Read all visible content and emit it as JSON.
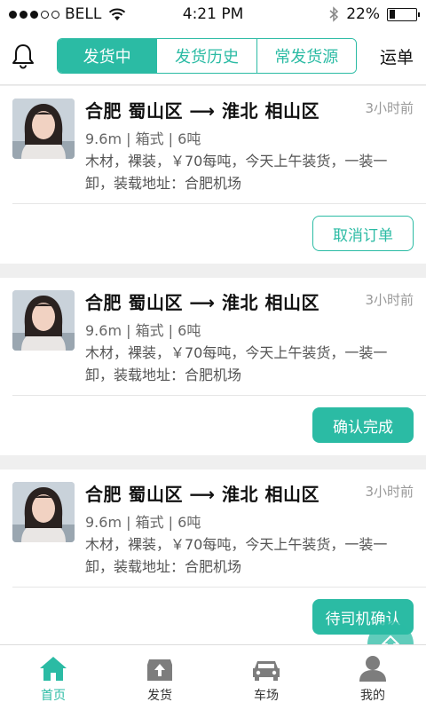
{
  "status_bar": {
    "carrier": "BELL",
    "time": "4:21 PM",
    "battery": "22%",
    "battery_level": 0.22
  },
  "nav": {
    "tabs": [
      {
        "label": "发货中",
        "active": true
      },
      {
        "label": "发货历史",
        "active": false
      },
      {
        "label": "常发货源",
        "active": false
      }
    ],
    "right_action": "运单"
  },
  "orders": [
    {
      "route": "合肥 蜀山区 ⟶ 淮北 相山区",
      "time_ago": "3小时前",
      "specs": "9.6m | 箱式 | 6吨",
      "description": "木材，裸装，￥70每吨，今天上午装货，一装一卸，装载地址：合肥机场",
      "action": "取消订单",
      "action_style": "outline"
    },
    {
      "route": "合肥 蜀山区 ⟶ 淮北 相山区",
      "time_ago": "3小时前",
      "specs": "9.6m | 箱式 | 6吨",
      "description": "木材，裸装，￥70每吨，今天上午装货，一装一卸，装载地址：合肥机场",
      "action": "确认完成",
      "action_style": "solid"
    },
    {
      "route": "合肥 蜀山区 ⟶ 淮北 相山区",
      "time_ago": "3小时前",
      "specs": "9.6m | 箱式 | 6吨",
      "description": "木材，裸装，￥70每吨，今天上午装货，一装一卸，装载地址：合肥机场",
      "action": "待司机确认",
      "action_style": "solid"
    }
  ],
  "tab_bar": {
    "items": [
      {
        "label": "首页",
        "icon": "home-icon",
        "active": true
      },
      {
        "label": "发货",
        "icon": "upload-box-icon",
        "active": false
      },
      {
        "label": "车场",
        "icon": "car-icon",
        "active": false
      },
      {
        "label": "我的",
        "icon": "user-icon",
        "active": false
      }
    ]
  },
  "colors": {
    "accent": "#2bbba4",
    "background": "#efefef"
  }
}
